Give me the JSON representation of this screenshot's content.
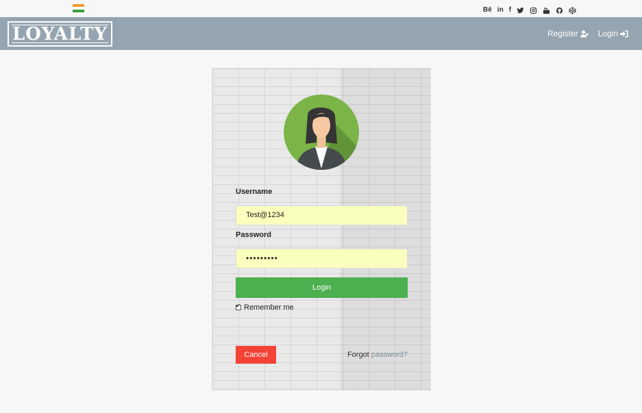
{
  "topbar": {
    "flag_colors": [
      "#f39a33",
      "#ffffff",
      "#3a9f3a"
    ],
    "social_icons": [
      "behance-icon",
      "linkedin-icon",
      "facebook-icon",
      "twitter-icon",
      "instagram-icon",
      "youtube-icon",
      "github-icon",
      "codepen-icon"
    ],
    "behance_text": "Bē",
    "linkedin_text": "in",
    "facebook_text": "f"
  },
  "navbar": {
    "logo": "LOYALTY",
    "register": "Register",
    "login": "Login",
    "color": "#94a5b1"
  },
  "form": {
    "username_label": "Username",
    "username_value": "Test@1234",
    "password_label": "Password",
    "password_value": "•••••••••",
    "login_button": "Login",
    "remember_me": "Remember me",
    "remember_checked": true,
    "cancel_button": "Cancel",
    "forgot_text": "Forgot",
    "forgot_link": "password?",
    "login_color": "#4caf50",
    "cancel_color": "#f44336"
  }
}
